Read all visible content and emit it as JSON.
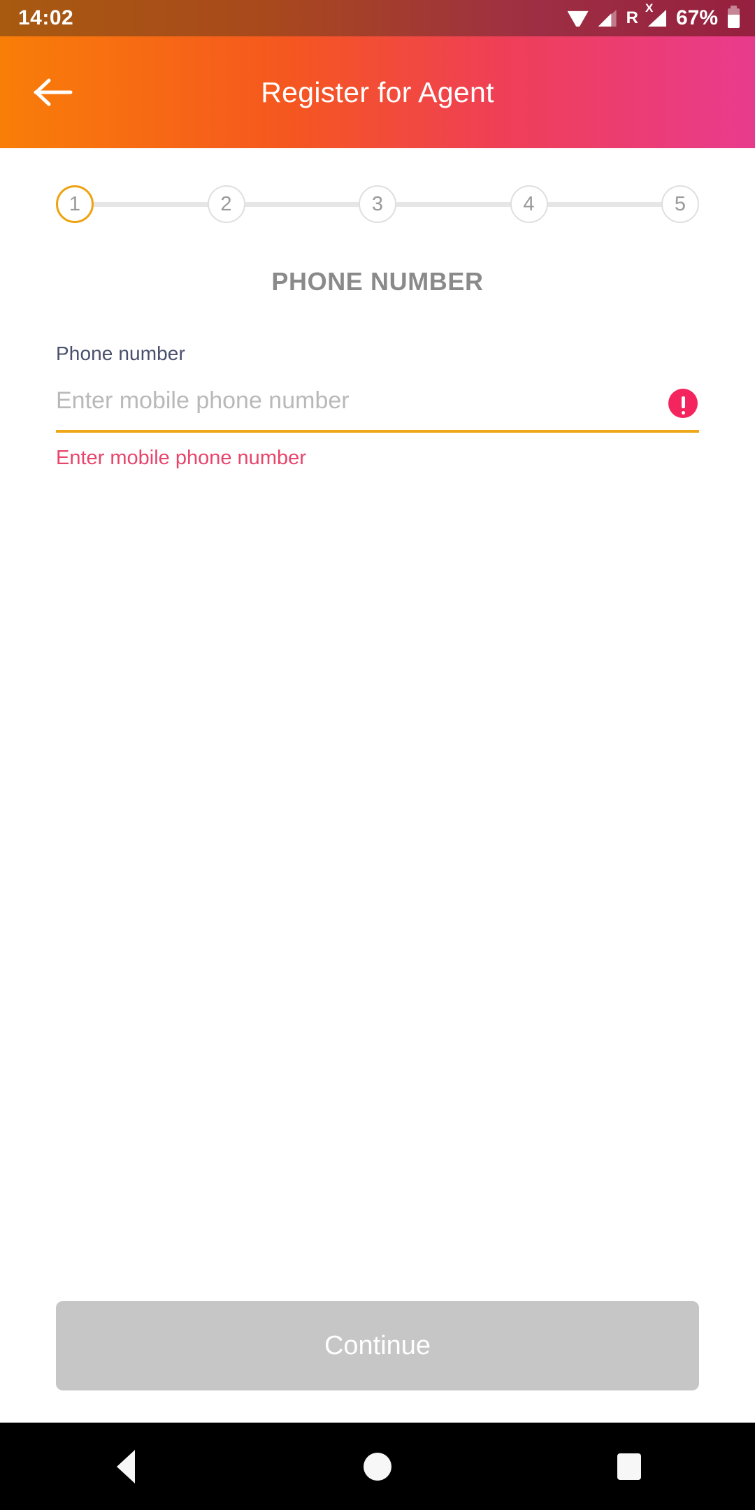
{
  "status_bar": {
    "time": "14:02",
    "battery_percent": "67%",
    "roaming_label": "R",
    "x_label": "X",
    "icons": [
      "wifi-icon",
      "signal-icon",
      "roaming-icon",
      "signal-x-icon",
      "battery-icon"
    ]
  },
  "app_bar": {
    "title": "Register for Agent",
    "back_icon": "arrow-left-icon",
    "gradient_start": "#F97E08",
    "gradient_end": "#E93B8E"
  },
  "stepper": {
    "active_index": 0,
    "active_color": "#EFA20F",
    "inactive_color": "#DFDFDF",
    "steps": [
      {
        "label": "1"
      },
      {
        "label": "2"
      },
      {
        "label": "3"
      },
      {
        "label": "4"
      },
      {
        "label": "5"
      }
    ]
  },
  "section": {
    "title": "PHONE NUMBER"
  },
  "form": {
    "phone_label": "Phone number",
    "phone_value": "",
    "phone_placeholder": "Enter mobile phone number",
    "error_message": "Enter mobile phone number",
    "error_icon": "error-exclamation-icon",
    "underline_color": "#EFA81C",
    "error_color": "#E8456B"
  },
  "footer": {
    "continue_label": "Continue",
    "continue_disabled": true,
    "disabled_color": "#C6C6C6"
  },
  "nav_bar": {
    "back_icon": "triangle-back-icon",
    "home_icon": "circle-home-icon",
    "recents_icon": "square-recents-icon"
  }
}
